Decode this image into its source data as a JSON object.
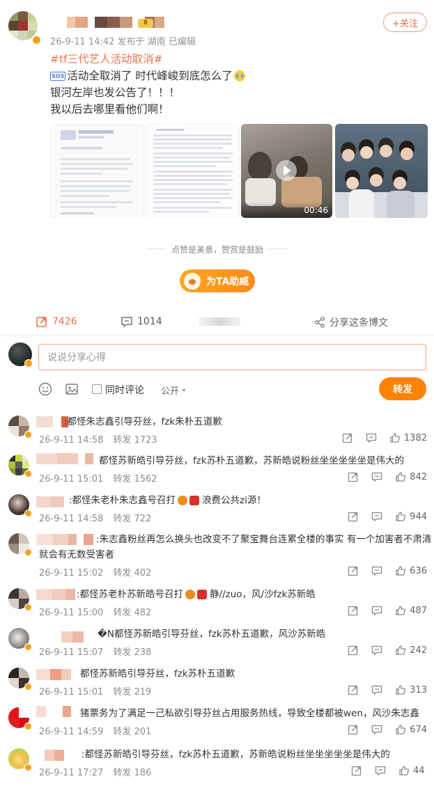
{
  "post": {
    "meta": "26-9-11 14:42 发布于 湖南  已编辑",
    "follow_label": "+关注",
    "hashtag": "#tf三代艺人活动取消#",
    "line1": "活动全取消了 时代峰峻到底怎么了",
    "sos": "SOS",
    "line2": "银河左岸也发公告了！！！",
    "line3": "我以后去哪里看他们啊！",
    "video_duration": "00:46"
  },
  "reward": {
    "text": "点赞是美意，赞赏是鼓励",
    "button": "为TA助威"
  },
  "actions": {
    "reposts": "7426",
    "comments": "1014",
    "share": "分享这条博文"
  },
  "composer": {
    "placeholder": "说说分享心得",
    "also_comment": "同时评论",
    "visibility": "公开",
    "submit": "转发"
  },
  "colors": {
    "accent": "#ff8200",
    "link": "#eb7350"
  },
  "comments": [
    {
      "text": ":都怪朱志鑫引导芬丝，fzk朱朴五道歉",
      "time": "26-9-11 14:58",
      "repost": "转发 1723",
      "likes": "1382"
    },
    {
      "text": "都怪苏新皓引导芬丝，fzk苏朴五道歉，苏新皓说粉丝坐坐坐坐坐是伟大的",
      "time": "26-9-11 15:01",
      "repost": "转发 1562",
      "likes": "842"
    },
    {
      "text": ":都怪朱老朴朱志鑫号召打",
      "text2": "浪费公共zi源！",
      "time": "26-9-11 14:58",
      "repost": "转发 722",
      "likes": "944"
    },
    {
      "text": ":朱志鑫粉丝再怎么换头也改变不了聚宝舞台连累全楼的事实 有一个加害者不肃清",
      "text_line2": "就会有无数受害者",
      "time": "26-9-11 15:02",
      "repost": "转发 402",
      "likes": "636"
    },
    {
      "text": ":都怪苏老朴苏新皓号召打",
      "text2": "静//zuo，风/沙fzk苏新皓",
      "time": "26-9-11 15:00",
      "repost": "转发 482",
      "likes": "487"
    },
    {
      "text": "�N都怪苏新皓引导芬丝，fzk苏朴五道歉，风沙苏新皓",
      "time": "26-9-11 15:07",
      "repost": "转发 238",
      "likes": "242"
    },
    {
      "text": "都怪苏新皓引导芬丝，fzk苏朴五道歉",
      "time": "26-9-11 15:01",
      "repost": "转发 219",
      "likes": "313"
    },
    {
      "text": "猪票务为了满足一己私欲引导芬丝占用服务热线，导致全楼都被wen，风沙朱志鑫",
      "time": "26-9-11 14:59",
      "repost": "转发 201",
      "likes": "674"
    },
    {
      "text": ":都怪苏新皓引导芬丝，fzk苏朴五道歉，苏新皓说粉丝坐坐坐坐坐是伟大的",
      "time": "26-9-11 17:27",
      "repost": "转发 186",
      "likes": "44"
    }
  ]
}
